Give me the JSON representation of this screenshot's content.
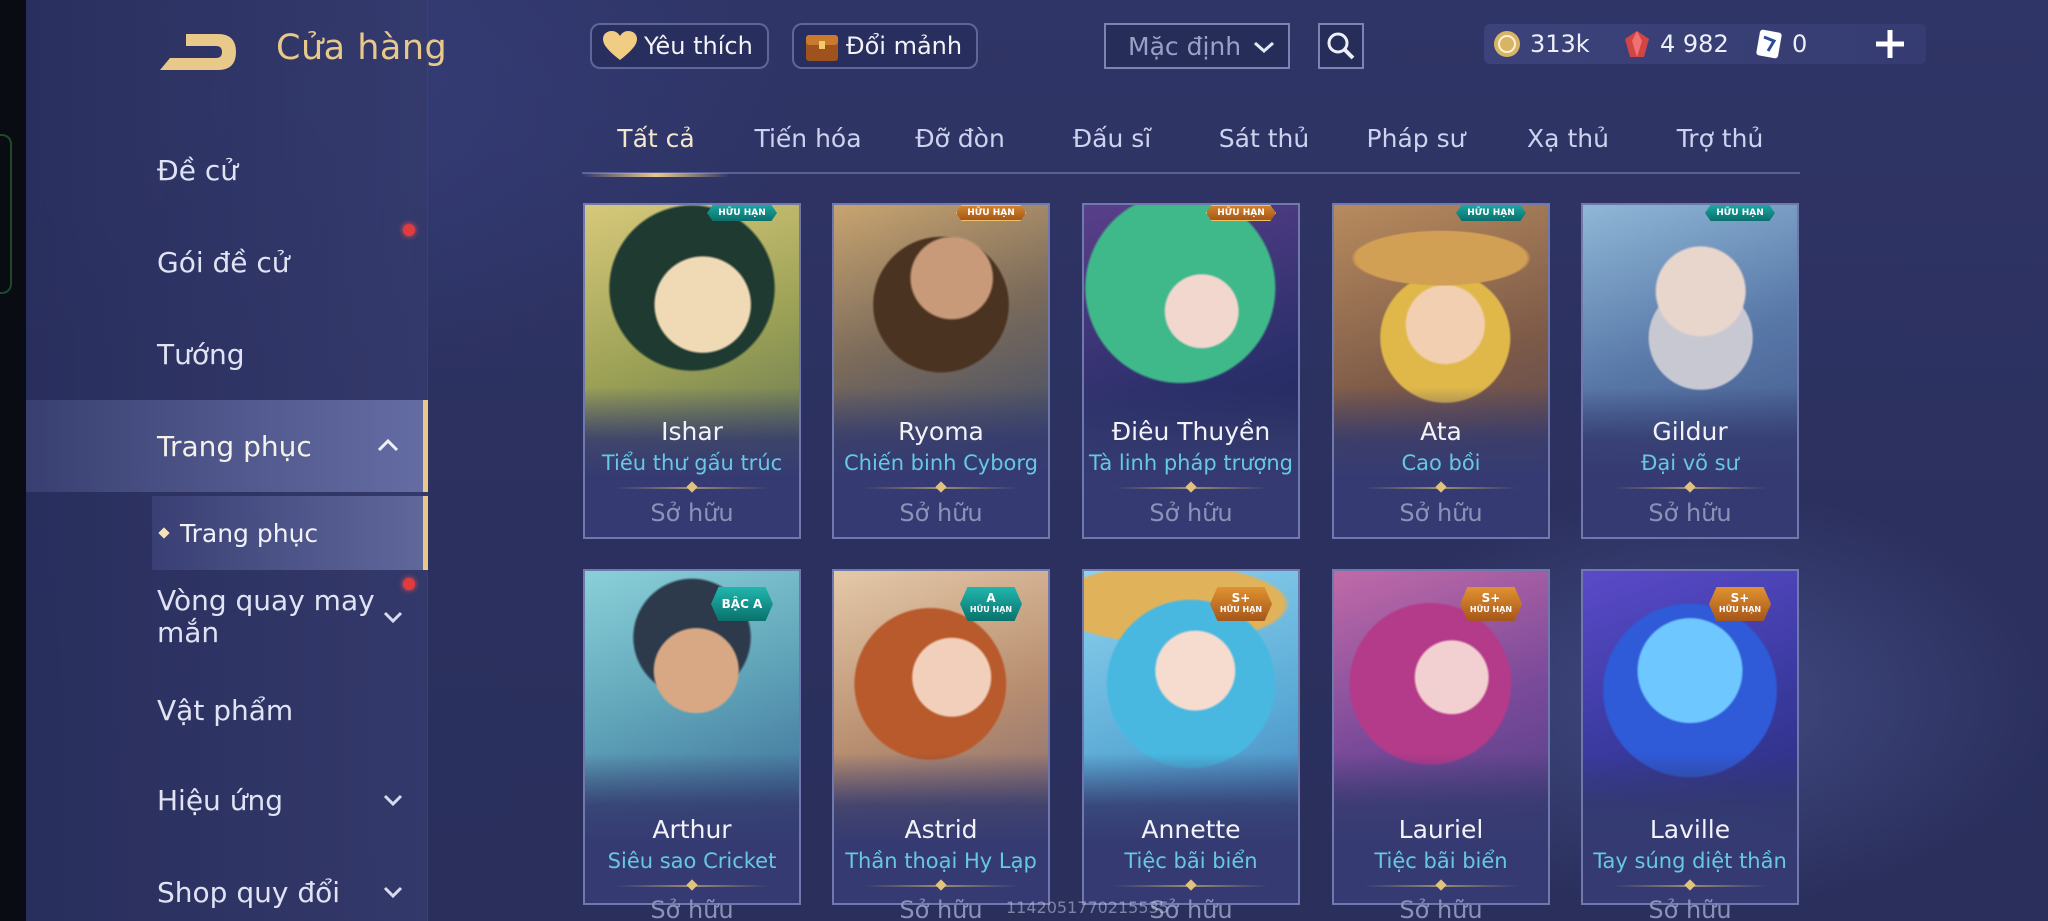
{
  "header": {
    "title": "Cửa hàng",
    "favorites_label": "Yêu thích",
    "exchange_label": "Đổi mảnh",
    "sort_value": "Mặc định",
    "gold": "313k",
    "gems": "4 982",
    "vouchers": "0"
  },
  "sidebar": {
    "items": [
      {
        "label": "Đề cử"
      },
      {
        "label": "Gói đề cử"
      },
      {
        "label": "Tướng"
      },
      {
        "label": "Trang phục"
      },
      {
        "label": "Vòng quay may mắn"
      },
      {
        "label": "Vật phẩm"
      },
      {
        "label": "Hiệu ứng"
      },
      {
        "label": "Shop quy đổi"
      }
    ],
    "sub_item": "Trang phục"
  },
  "tabs": [
    "Tất cả",
    "Tiến hóa",
    "Đỡ đòn",
    "Đấu sĩ",
    "Sát thủ",
    "Pháp sư",
    "Xạ thủ",
    "Trợ thủ"
  ],
  "cards": [
    {
      "hero": "Ishar",
      "skin": "Tiểu thư gấu trúc",
      "status": "Sở hữu",
      "badge": "HỮU HẠN"
    },
    {
      "hero": "Ryoma",
      "skin": "Chiến binh Cyborg",
      "status": "Sở hữu",
      "badge": "HỮU HẠN"
    },
    {
      "hero": "Điêu Thuyền",
      "skin": "Tà linh pháp trượng",
      "status": "Sở hữu",
      "badge": "HỮU HẠN"
    },
    {
      "hero": "Ata",
      "skin": "Cao bồi",
      "status": "Sở hữu",
      "badge": "HỮU HẠN"
    },
    {
      "hero": "Gildur",
      "skin": "Đại võ sư",
      "status": "Sở hữu",
      "badge": "HỮU HẠN"
    },
    {
      "hero": "Arthur",
      "skin": "Siêu sao Cricket",
      "status": "Sở hữu",
      "badge": "BẬC A"
    },
    {
      "hero": "Astrid",
      "skin": "Thần thoại Hy Lạp",
      "status": "Sở hữu",
      "badge": "A",
      "badge_sub": "HỮU HẠN"
    },
    {
      "hero": "Annette",
      "skin": "Tiệc bãi biển",
      "status": "Sở hữu",
      "badge": "S+",
      "badge_sub": "HỮU HẠN"
    },
    {
      "hero": "Lauriel",
      "skin": "Tiệc bãi biển",
      "status": "Sở hữu",
      "badge": "S+",
      "badge_sub": "HỮU HẠN"
    },
    {
      "hero": "Laville",
      "skin": "Tay súng diệt thần",
      "status": "Sở hữu",
      "badge": "S+",
      "badge_sub": "HỮU HẠN"
    }
  ],
  "watermark": "1142051770215535",
  "colors": {
    "accent_gold": "#e9c98a",
    "skin_name": "#66c8e4",
    "notification": "#e23b3b"
  }
}
